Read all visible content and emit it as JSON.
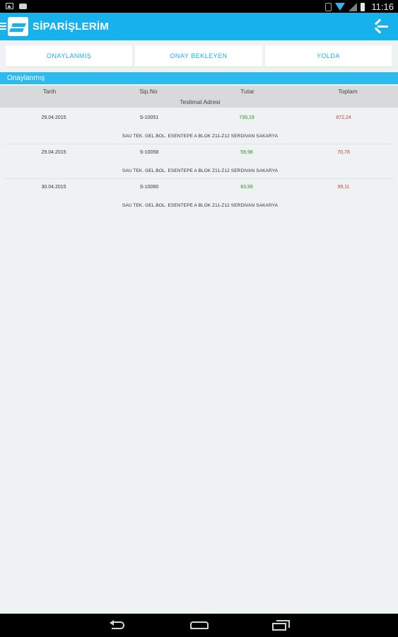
{
  "status_bar": {
    "time": "11:16",
    "icons": [
      "image-icon",
      "message-icon",
      "vibrate-icon",
      "wifi-icon",
      "signal-icon",
      "battery-icon"
    ]
  },
  "action_bar": {
    "title": "SİPARİŞLERİM",
    "icons": [
      "menu-icon",
      "app-logo-icon",
      "back-arrow-icon"
    ],
    "color": "#17b2ec"
  },
  "tabs": [
    {
      "label": "ONAYLANMIŞ"
    },
    {
      "label": "ONAY BEKLEYEN"
    },
    {
      "label": "YOLDA"
    }
  ],
  "section": {
    "title": "Onaylanmış"
  },
  "table": {
    "headers": {
      "tarih": "Tarih",
      "sipno": "Sip.No",
      "tutar": "Tutar",
      "toplam": "Toplam",
      "address": "Teslimat Adresi"
    },
    "rows": [
      {
        "tarih": "29.04.2015",
        "sipno": "S-10051",
        "tutar": "739,19",
        "toplam": "872,24",
        "address": "SAU TEK. GEL.BOL. ESENTEPE  A BLOK Z11-Z12 SERDIVAN SAKARYA"
      },
      {
        "tarih": "29.04.2015",
        "sipno": "S-10058",
        "tutar": "59,98",
        "toplam": "70,78",
        "address": "SAU TEK. GEL.BOL. ESENTEPE  A BLOK Z11-Z12 SERDIVAN SAKARYA"
      },
      {
        "tarih": "30.04.2015",
        "sipno": "S-10060",
        "tutar": "83,99",
        "toplam": "99,11",
        "address": "SAU TEK. GEL.BOL. ESENTEPE  A BLOK Z11-Z12 SERDIVAN SAKARYA"
      }
    ]
  },
  "nav_bar": {
    "icons": [
      "back-nav-icon",
      "home-nav-icon",
      "recent-apps-icon"
    ]
  },
  "colors": {
    "accent": "#17b2ec",
    "tutar": "#2e8b2e",
    "toplam": "#d23a3a"
  }
}
